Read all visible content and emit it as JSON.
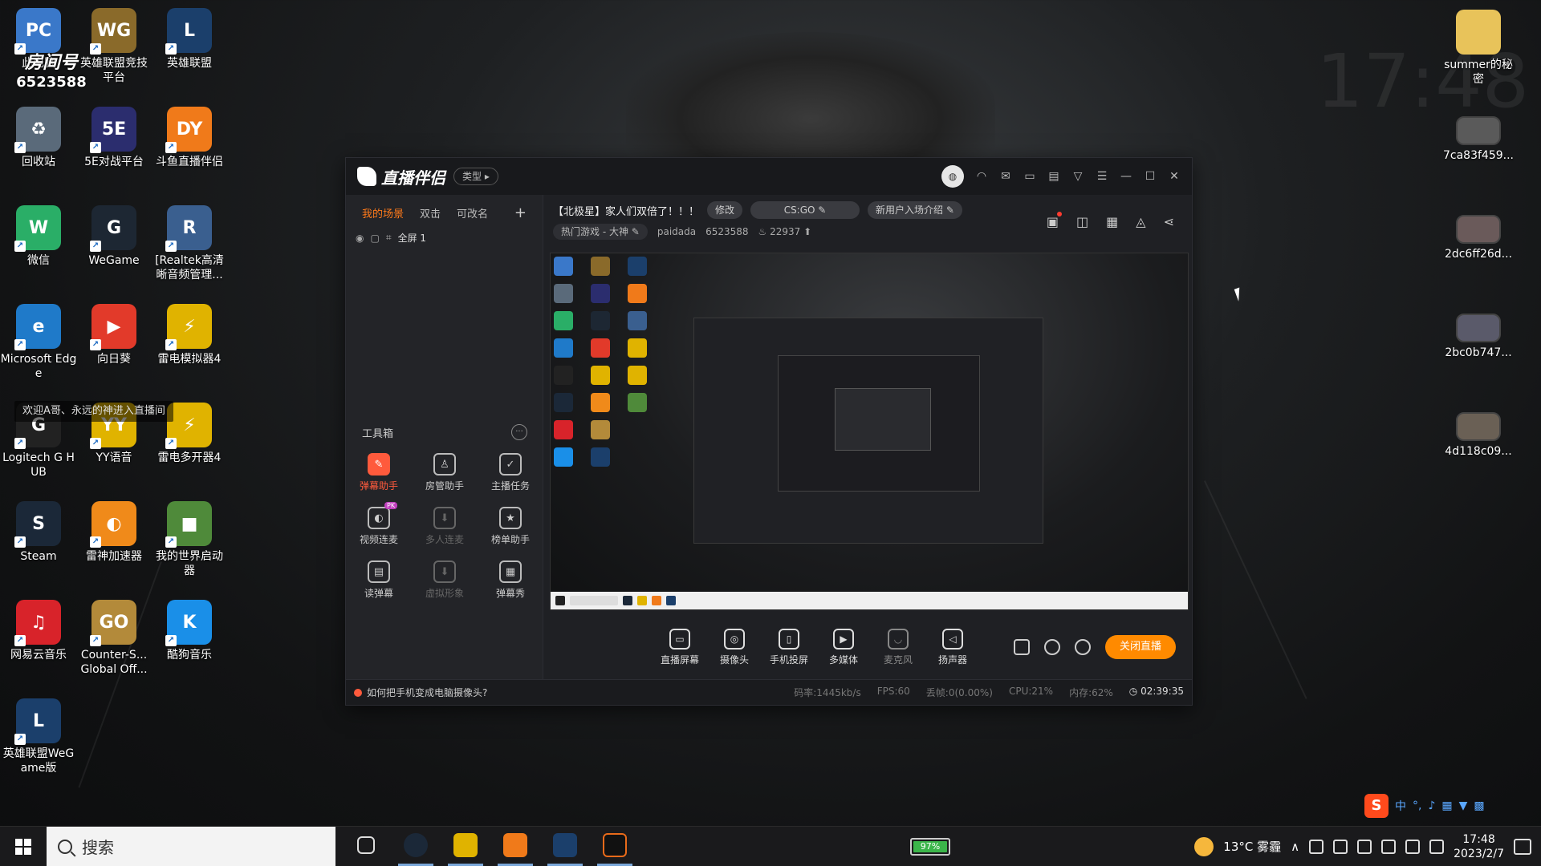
{
  "background": {
    "clock": "17:48"
  },
  "room_overlay": {
    "title": "房间号",
    "number": "6523588"
  },
  "welcome_banner": "欢迎A哥、永远的神进入直播间",
  "desktop_icons_left": [
    {
      "label": "此电脑",
      "color": "#3a78c9",
      "glyph": "PC"
    },
    {
      "label": "英雄联盟竞技平台",
      "color": "#8a6a2a",
      "glyph": "WG"
    },
    {
      "label": "英雄联盟",
      "color": "#1b3f6b",
      "glyph": "L"
    },
    {
      "label": "回收站",
      "color": "#5a6a7a",
      "glyph": "♻"
    },
    {
      "label": "5E对战平台",
      "color": "#2b2d6e",
      "glyph": "5E"
    },
    {
      "label": "斗鱼直播伴侣",
      "color": "#f07a1a",
      "glyph": "DY"
    },
    {
      "label": "微信",
      "color": "#2aae67",
      "glyph": "W"
    },
    {
      "label": "WeGame",
      "color": "#1d2733",
      "glyph": "G"
    },
    {
      "label": "[Realtek高清晰音频管理...",
      "color": "#3a5f8f",
      "glyph": "R"
    },
    {
      "label": "Microsoft Edge",
      "color": "#1f7ac9",
      "glyph": "e"
    },
    {
      "label": "向日葵",
      "color": "#e23a2a",
      "glyph": "▶"
    },
    {
      "label": "雷电模拟器4",
      "color": "#e0b300",
      "glyph": "⚡"
    },
    {
      "label": "Logitech G HUB",
      "color": "#222222",
      "glyph": "G"
    },
    {
      "label": "YY语音",
      "color": "#e0b300",
      "glyph": "YY"
    },
    {
      "label": "雷电多开器4",
      "color": "#e0b300",
      "glyph": "⚡"
    },
    {
      "label": "Steam",
      "color": "#1b2838",
      "glyph": "S"
    },
    {
      "label": "雷神加速器",
      "color": "#f08a1a",
      "glyph": "◐"
    },
    {
      "label": "我的世界启动器",
      "color": "#4f8a3a",
      "glyph": "■"
    },
    {
      "label": "网易云音乐",
      "color": "#d8232a",
      "glyph": "♫"
    },
    {
      "label": "Counter-S... Global Off...",
      "color": "#b38a3a",
      "glyph": "GO"
    },
    {
      "label": "酷狗音乐",
      "color": "#1a8fe8",
      "glyph": "K"
    },
    {
      "label": "英雄联盟WeGame版",
      "color": "#1b3f6b",
      "glyph": "L"
    }
  ],
  "desktop_icons_right": [
    {
      "label": "summer的秘密",
      "color": "#e8c35a",
      "glyph": ""
    },
    {
      "label": "7ca83f459...",
      "color": "#5a5a5a",
      "glyph": ""
    },
    {
      "label": "2dc6ff26d...",
      "color": "#6a5a5a",
      "glyph": ""
    },
    {
      "label": "2bc0b747...",
      "color": "#5a5a6a",
      "glyph": ""
    },
    {
      "label": "4d118c09...",
      "color": "#6a6055",
      "glyph": ""
    }
  ],
  "app": {
    "logo": "直播伴侣",
    "type_button": "类型",
    "avatar_text": "头像",
    "scene_tabs": [
      "我的场景",
      "双击",
      "可改名"
    ],
    "scene_item": "全屏 1",
    "toolbox_title": "工具箱",
    "tools": [
      {
        "label": "弹幕助手",
        "state": "active"
      },
      {
        "label": "房管助手",
        "state": ""
      },
      {
        "label": "主播任务",
        "state": ""
      },
      {
        "label": "视频连麦",
        "state": "",
        "badge": "PK"
      },
      {
        "label": "多人连麦",
        "state": "dim"
      },
      {
        "label": "榜单助手",
        "state": ""
      },
      {
        "label": "读弹幕",
        "state": ""
      },
      {
        "label": "虚拟形象",
        "state": "dim"
      },
      {
        "label": "弹幕秀",
        "state": ""
      }
    ],
    "header": {
      "title": "【北极星】家人们双倍了！！！",
      "edit": "修改",
      "game": "CS:GO",
      "intro": "新用户入场介绍",
      "category": "热门游戏 - 大神",
      "username": "paidada",
      "room_id": "6523588",
      "heat": "22937"
    },
    "controls": [
      "直播屏幕",
      "摄像头",
      "手机投屏",
      "多媒体",
      "麦克风",
      "扬声器"
    ],
    "stop_button": "关闭直播",
    "status": {
      "tip": "如何把手机变成电脑摄像头?",
      "bitrate": "码率:1445kb/s",
      "fps": "FPS:60",
      "drop": "丢帧:0(0.00%)",
      "cpu": "CPU:21%",
      "mem": "内存:62%",
      "timer": "02:39:35"
    }
  },
  "taskbar": {
    "search_placeholder": "搜索",
    "battery": "97%",
    "weather": "13°C 雾霾",
    "time": "17:48",
    "date": "2023/2/7",
    "ime": "中"
  }
}
